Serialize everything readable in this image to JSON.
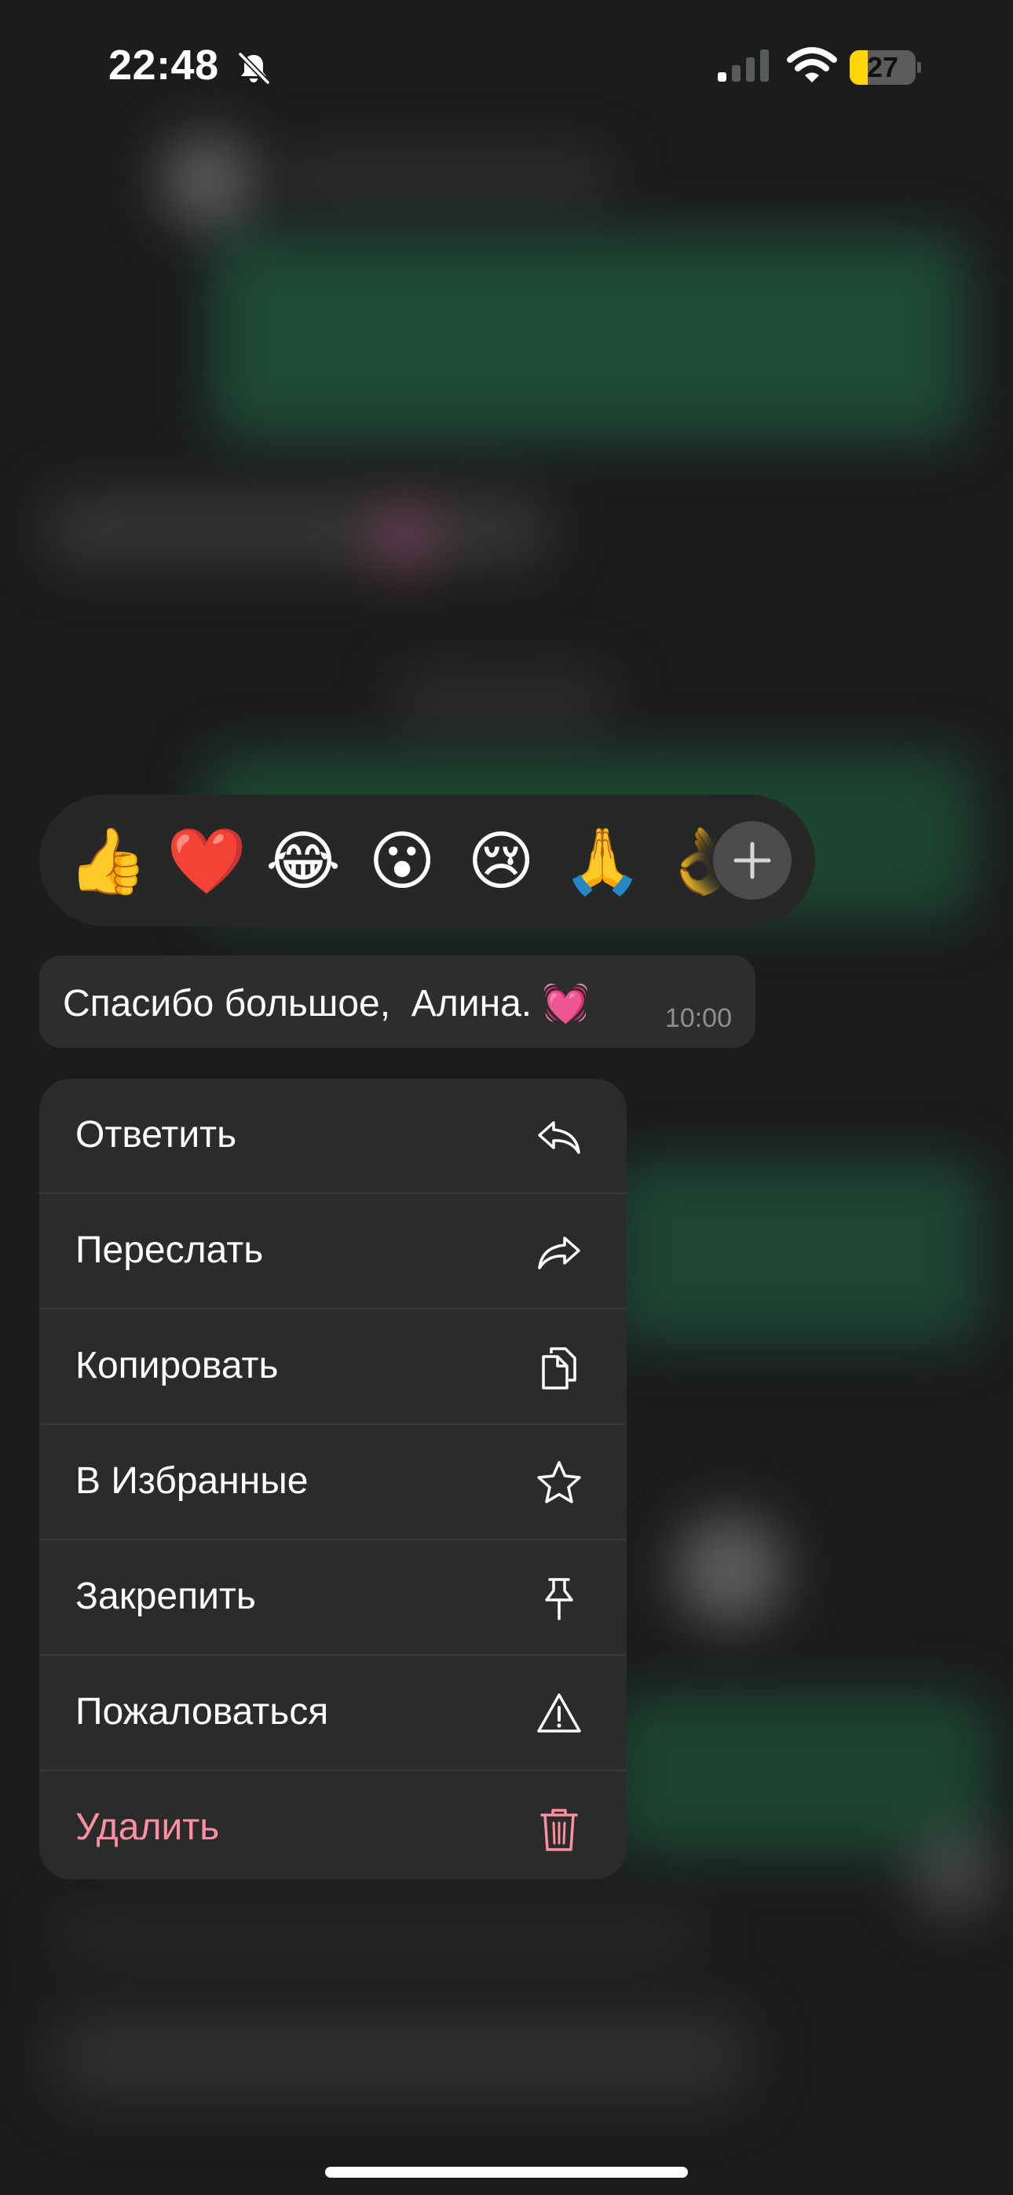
{
  "status_bar": {
    "time": "22:48",
    "battery_level": "27",
    "battery_percent": 27,
    "silent_mode": true
  },
  "reactions": [
    {
      "emoji": "👍",
      "name": "thumbs-up-icon"
    },
    {
      "emoji": "❤️",
      "name": "red-heart-icon"
    },
    {
      "emoji": "😂",
      "name": "tears-of-joy-icon"
    },
    {
      "emoji": "😮",
      "name": "surprised-face-icon"
    },
    {
      "emoji": "😢",
      "name": "crying-face-icon"
    },
    {
      "emoji": "🙏",
      "name": "folded-hands-icon"
    },
    {
      "emoji": "👌",
      "name": "ok-hand-icon"
    }
  ],
  "message": {
    "text": "Спасибо большое,  Алина. 💓",
    "time": "10:00"
  },
  "menu": {
    "reply": {
      "label": "Ответить",
      "icon": "reply-arrow-icon"
    },
    "forward": {
      "label": "Переслать",
      "icon": "forward-arrow-icon"
    },
    "copy": {
      "label": "Копировать",
      "icon": "copy-documents-icon"
    },
    "favorite": {
      "label": "В Избранные",
      "icon": "star-icon"
    },
    "pin": {
      "label": "Закрепить",
      "icon": "pin-icon"
    },
    "report": {
      "label": "Пожаловаться",
      "icon": "warning-triangle-icon"
    },
    "delete": {
      "label": "Удалить",
      "icon": "trash-icon"
    }
  },
  "colors": {
    "menu_background": "#2a2c2c",
    "destructive": "#ff8fa0",
    "battery_yellow": "#ffd60a",
    "chat_bubble_green": "#1e4a36"
  }
}
